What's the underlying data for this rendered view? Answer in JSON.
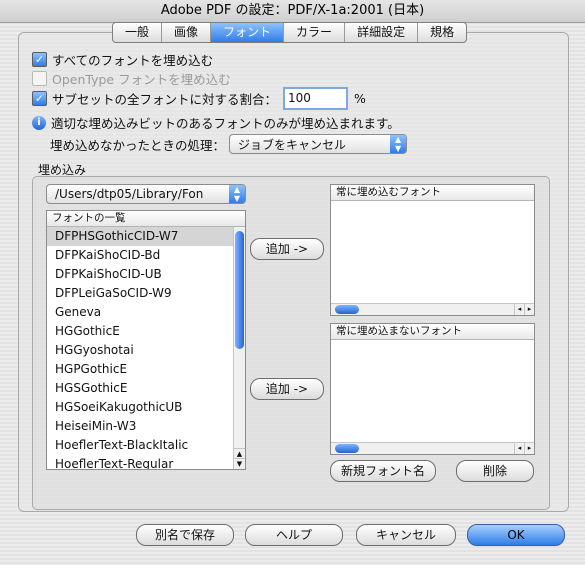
{
  "window": {
    "title": "Adobe PDF の設定：PDF/X-1a:2001 (日本)"
  },
  "tabs": [
    {
      "label": "一般"
    },
    {
      "label": "画像"
    },
    {
      "label": "フォント"
    },
    {
      "label": "カラー"
    },
    {
      "label": "詳細設定"
    },
    {
      "label": "規格"
    }
  ],
  "options": {
    "embed_all": {
      "label": "すべてのフォントを埋め込む",
      "checked": true
    },
    "opentype": {
      "label": "OpenType フォントを埋め込む",
      "checked": false
    },
    "subset": {
      "label": "サブセットの全フォントに対する割合：",
      "value": "100",
      "unit": "%",
      "checked": true
    },
    "info": {
      "text": "適切な埋め込みビットのあるフォントのみが埋め込まれます。"
    },
    "fail_action": {
      "label": "埋め込めなかったときの処理：",
      "value": "ジョブをキャンセル"
    }
  },
  "embed": {
    "group_label": "埋め込み",
    "path_popup": "/Users/dtp05/Library/Fon",
    "font_list_header": "フォントの一覧",
    "fonts": [
      "DFPHSGothicCID-W7",
      "DFPKaiShoCID-Bd",
      "DFPKaiShoCID-UB",
      "DFPLeiGaSoCID-W9",
      "Geneva",
      "HGGothicE",
      "HGGyoshotai",
      "HGPGothicE",
      "HGSGothicE",
      "HGSoeiKakugothicUB",
      "HeiseiMin-W3",
      "HoeflerText-BlackItalic",
      "HoeflerText-Regular"
    ],
    "add_label_1": "追加 ->",
    "add_label_2": "追加 ->",
    "always_embed_header": "常に埋め込むフォント",
    "never_embed_header": "常に埋め込まないフォント",
    "new_font_button": "新規フォント名",
    "delete_button": "削除"
  },
  "footer": {
    "save_as": "別名で保存",
    "help": "ヘルプ",
    "cancel": "キャンセル",
    "ok": "OK"
  },
  "colors": {
    "accent": "#2f7de6"
  }
}
